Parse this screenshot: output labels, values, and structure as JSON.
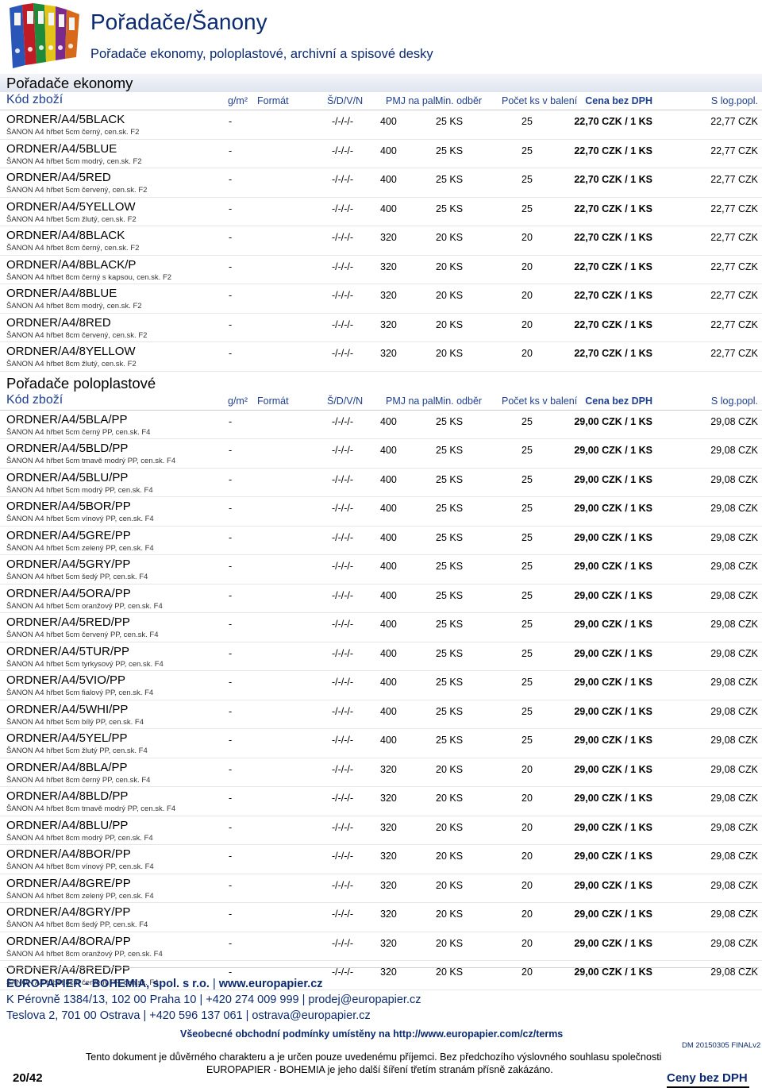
{
  "header": {
    "title": "Pořadače/Šanony",
    "subtitle": "Pořadače ekonomy, poloplastové, archivní a spisové desky"
  },
  "columns": {
    "kod": "Kód zboží",
    "g": "g/m²",
    "format": "Formát",
    "sdvn": "Š/D/V/N",
    "pmj": "PMJ na pal.",
    "min": "Min. odběr",
    "pocet": "Počet ks v balení",
    "cena": "Cena bez DPH",
    "slog": "S log.popl."
  },
  "sections": [
    {
      "title": "Pořadače ekonomy",
      "rows": [
        {
          "code": "ORDNER/A4/5BLACK",
          "desc": "ŠANON A4 hřbet 5cm černý, cen.sk. F2",
          "g": "-",
          "sdvn": "-/-/-/-",
          "pmj": "400",
          "min": "25 KS",
          "pocet": "25",
          "cena": "22,70 CZK / 1 KS",
          "slog": "22,77 CZK"
        },
        {
          "code": "ORDNER/A4/5BLUE",
          "desc": "ŠANON A4 hřbet 5cm modrý, cen.sk. F2",
          "g": "-",
          "sdvn": "-/-/-/-",
          "pmj": "400",
          "min": "25 KS",
          "pocet": "25",
          "cena": "22,70 CZK / 1 KS",
          "slog": "22,77 CZK"
        },
        {
          "code": "ORDNER/A4/5RED",
          "desc": "ŠANON A4 hřbet 5cm červený, cen.sk. F2",
          "g": "-",
          "sdvn": "-/-/-/-",
          "pmj": "400",
          "min": "25 KS",
          "pocet": "25",
          "cena": "22,70 CZK / 1 KS",
          "slog": "22,77 CZK"
        },
        {
          "code": "ORDNER/A4/5YELLOW",
          "desc": "ŠANON A4 hřbet 5cm žlutý, cen.sk. F2",
          "g": "-",
          "sdvn": "-/-/-/-",
          "pmj": "400",
          "min": "25 KS",
          "pocet": "25",
          "cena": "22,70 CZK / 1 KS",
          "slog": "22,77 CZK"
        },
        {
          "code": "ORDNER/A4/8BLACK",
          "desc": "ŠANON A4 hřbet 8cm černý, cen.sk. F2",
          "g": "-",
          "sdvn": "-/-/-/-",
          "pmj": "320",
          "min": "20 KS",
          "pocet": "20",
          "cena": "22,70 CZK / 1 KS",
          "slog": "22,77 CZK"
        },
        {
          "code": "ORDNER/A4/8BLACK/P",
          "desc": "ŠANON A4 hřbet 8cm černý s kapsou, cen.sk. F2",
          "g": "-",
          "sdvn": "-/-/-/-",
          "pmj": "320",
          "min": "20 KS",
          "pocet": "20",
          "cena": "22,70 CZK / 1 KS",
          "slog": "22,77 CZK"
        },
        {
          "code": "ORDNER/A4/8BLUE",
          "desc": "ŠANON A4 hřbet 8cm modrý, cen.sk. F2",
          "g": "-",
          "sdvn": "-/-/-/-",
          "pmj": "320",
          "min": "20 KS",
          "pocet": "20",
          "cena": "22,70 CZK / 1 KS",
          "slog": "22,77 CZK"
        },
        {
          "code": "ORDNER/A4/8RED",
          "desc": "ŠANON A4 hřbet 8cm červený, cen.sk. F2",
          "g": "-",
          "sdvn": "-/-/-/-",
          "pmj": "320",
          "min": "20 KS",
          "pocet": "20",
          "cena": "22,70 CZK / 1 KS",
          "slog": "22,77 CZK"
        },
        {
          "code": "ORDNER/A4/8YELLOW",
          "desc": "ŠANON A4 hřbet 8cm žlutý, cen.sk. F2",
          "g": "-",
          "sdvn": "-/-/-/-",
          "pmj": "320",
          "min": "20 KS",
          "pocet": "20",
          "cena": "22,70 CZK / 1 KS",
          "slog": "22,77 CZK"
        }
      ]
    },
    {
      "title": "Pořadače poloplastové",
      "rows": [
        {
          "code": "ORDNER/A4/5BLA/PP",
          "desc": "ŠANON A4 hřbet 5cm černý PP, cen.sk. F4",
          "g": "-",
          "sdvn": "-/-/-/-",
          "pmj": "400",
          "min": "25 KS",
          "pocet": "25",
          "cena": "29,00 CZK / 1 KS",
          "slog": "29,08 CZK"
        },
        {
          "code": "ORDNER/A4/5BLD/PP",
          "desc": "ŠANON A4 hřbet 5cm tmavě modrý PP, cen.sk. F4",
          "g": "-",
          "sdvn": "-/-/-/-",
          "pmj": "400",
          "min": "25 KS",
          "pocet": "25",
          "cena": "29,00 CZK / 1 KS",
          "slog": "29,08 CZK"
        },
        {
          "code": "ORDNER/A4/5BLU/PP",
          "desc": "ŠANON A4 hřbet 5cm modrý PP, cen.sk. F4",
          "g": "-",
          "sdvn": "-/-/-/-",
          "pmj": "400",
          "min": "25 KS",
          "pocet": "25",
          "cena": "29,00 CZK / 1 KS",
          "slog": "29,08 CZK"
        },
        {
          "code": "ORDNER/A4/5BOR/PP",
          "desc": "ŠANON A4 hřbet 5cm vínový PP, cen.sk. F4",
          "g": "-",
          "sdvn": "-/-/-/-",
          "pmj": "400",
          "min": "25 KS",
          "pocet": "25",
          "cena": "29,00 CZK / 1 KS",
          "slog": "29,08 CZK"
        },
        {
          "code": "ORDNER/A4/5GRE/PP",
          "desc": "ŠANON A4 hřbet 5cm zelený PP, cen.sk. F4",
          "g": "-",
          "sdvn": "-/-/-/-",
          "pmj": "400",
          "min": "25 KS",
          "pocet": "25",
          "cena": "29,00 CZK / 1 KS",
          "slog": "29,08 CZK"
        },
        {
          "code": "ORDNER/A4/5GRY/PP",
          "desc": "ŠANON A4 hřbet 5cm šedý PP, cen.sk. F4",
          "g": "-",
          "sdvn": "-/-/-/-",
          "pmj": "400",
          "min": "25 KS",
          "pocet": "25",
          "cena": "29,00 CZK / 1 KS",
          "slog": "29,08 CZK"
        },
        {
          "code": "ORDNER/A4/5ORA/PP",
          "desc": "ŠANON A4 hřbet 5cm oranžový PP, cen.sk. F4",
          "g": "-",
          "sdvn": "-/-/-/-",
          "pmj": "400",
          "min": "25 KS",
          "pocet": "25",
          "cena": "29,00 CZK / 1 KS",
          "slog": "29,08 CZK"
        },
        {
          "code": "ORDNER/A4/5RED/PP",
          "desc": "ŠANON A4 hřbet 5cm červený PP, cen.sk. F4",
          "g": "-",
          "sdvn": "-/-/-/-",
          "pmj": "400",
          "min": "25 KS",
          "pocet": "25",
          "cena": "29,00 CZK / 1 KS",
          "slog": "29,08 CZK"
        },
        {
          "code": "ORDNER/A4/5TUR/PP",
          "desc": "ŠANON A4 hřbet 5cm tyrkysový PP, cen.sk. F4",
          "g": "-",
          "sdvn": "-/-/-/-",
          "pmj": "400",
          "min": "25 KS",
          "pocet": "25",
          "cena": "29,00 CZK / 1 KS",
          "slog": "29,08 CZK"
        },
        {
          "code": "ORDNER/A4/5VIO/PP",
          "desc": "ŠANON A4 hřbet 5cm fialový PP, cen.sk. F4",
          "g": "-",
          "sdvn": "-/-/-/-",
          "pmj": "400",
          "min": "25 KS",
          "pocet": "25",
          "cena": "29,00 CZK / 1 KS",
          "slog": "29,08 CZK"
        },
        {
          "code": "ORDNER/A4/5WHI/PP",
          "desc": "ŠANON A4 hřbet 5cm bílý PP, cen.sk. F4",
          "g": "-",
          "sdvn": "-/-/-/-",
          "pmj": "400",
          "min": "25 KS",
          "pocet": "25",
          "cena": "29,00 CZK / 1 KS",
          "slog": "29,08 CZK"
        },
        {
          "code": "ORDNER/A4/5YEL/PP",
          "desc": "ŠANON A4 hřbet 5cm žlutý PP, cen.sk. F4",
          "g": "-",
          "sdvn": "-/-/-/-",
          "pmj": "400",
          "min": "25 KS",
          "pocet": "25",
          "cena": "29,00 CZK / 1 KS",
          "slog": "29,08 CZK"
        },
        {
          "code": "ORDNER/A4/8BLA/PP",
          "desc": "ŠANON A4 hřbet 8cm černý PP, cen.sk. F4",
          "g": "-",
          "sdvn": "-/-/-/-",
          "pmj": "320",
          "min": "20 KS",
          "pocet": "20",
          "cena": "29,00 CZK / 1 KS",
          "slog": "29,08 CZK"
        },
        {
          "code": "ORDNER/A4/8BLD/PP",
          "desc": "ŠANON A4 hřbet 8cm tmavě modrý PP, cen.sk. F4",
          "g": "-",
          "sdvn": "-/-/-/-",
          "pmj": "320",
          "min": "20 KS",
          "pocet": "20",
          "cena": "29,00 CZK / 1 KS",
          "slog": "29,08 CZK"
        },
        {
          "code": "ORDNER/A4/8BLU/PP",
          "desc": "ŠANON A4 hřbet 8cm modrý PP, cen.sk. F4",
          "g": "-",
          "sdvn": "-/-/-/-",
          "pmj": "320",
          "min": "20 KS",
          "pocet": "20",
          "cena": "29,00 CZK / 1 KS",
          "slog": "29,08 CZK"
        },
        {
          "code": "ORDNER/A4/8BOR/PP",
          "desc": "ŠANON A4 hřbet 8cm vínový PP, cen.sk. F4",
          "g": "-",
          "sdvn": "-/-/-/-",
          "pmj": "320",
          "min": "20 KS",
          "pocet": "20",
          "cena": "29,00 CZK / 1 KS",
          "slog": "29,08 CZK"
        },
        {
          "code": "ORDNER/A4/8GRE/PP",
          "desc": "ŠANON A4 hřbet 8cm zelený PP, cen.sk. F4",
          "g": "-",
          "sdvn": "-/-/-/-",
          "pmj": "320",
          "min": "20 KS",
          "pocet": "20",
          "cena": "29,00 CZK / 1 KS",
          "slog": "29,08 CZK"
        },
        {
          "code": "ORDNER/A4/8GRY/PP",
          "desc": "ŠANON A4 hřbet 8cm šedý PP, cen.sk. F4",
          "g": "-",
          "sdvn": "-/-/-/-",
          "pmj": "320",
          "min": "20 KS",
          "pocet": "20",
          "cena": "29,00 CZK / 1 KS",
          "slog": "29,08 CZK"
        },
        {
          "code": "ORDNER/A4/8ORA/PP",
          "desc": "ŠANON A4 hřbet 8cm oranžový PP, cen.sk. F4",
          "g": "-",
          "sdvn": "-/-/-/-",
          "pmj": "320",
          "min": "20 KS",
          "pocet": "20",
          "cena": "29,00 CZK / 1 KS",
          "slog": "29,08 CZK"
        },
        {
          "code": "ORDNER/A4/8RED/PP",
          "desc": "ŠANON A4 hřbet 8cm červený PP, cen.sk. F4",
          "g": "-",
          "sdvn": "-/-/-/-",
          "pmj": "320",
          "min": "20 KS",
          "pocet": "20",
          "cena": "29,00 CZK / 1 KS",
          "slog": "29,08 CZK"
        }
      ]
    }
  ],
  "footer": {
    "company": "EUROPAPIER - BOHEMIA, spol. s r.o.",
    "web": "www.europapier.cz",
    "address_line1": "K Pérovně 1384/13, 102 00 Praha 10 | +420 274 009 999 | prodej@europapier.cz",
    "address_line2": "Teslova 2, 701 00 Ostrava | +420 596 137 061 | ostrava@europapier.cz",
    "terms": "Všeobecné obchodní podmínky umístěny na http://www.europapier.com/cz/terms",
    "confidential_line1": "Tento dokument je důvěrného charakteru a je určen pouze uvedenému příjemci. Bez předchozího výslovného souhlasu společnosti",
    "confidential_line2": "EUROPAPIER - BOHEMIA je jeho další šíření třetím stranám přísně zakázáno.",
    "version": "DM 20150305 FINALv2",
    "page_number": "20/42",
    "catalog_label": "Ceny bez DPH"
  },
  "colors": {
    "brand_blue": "#0b2a6f",
    "header_blue": "#1f3f8f",
    "section_band": "#e6eaf2"
  },
  "icons": {
    "logo": "binders-photo-icon"
  }
}
